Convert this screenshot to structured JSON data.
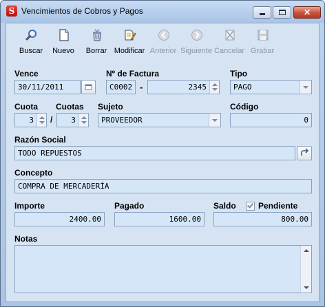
{
  "window": {
    "title": "Vencimientos de Cobros y Pagos",
    "app_icon_letter": "S",
    "minimize_icon": "minimize-icon",
    "maximize_icon": "maximize-icon",
    "close_glyph": "✕"
  },
  "toolbar": {
    "items": [
      {
        "label": "Buscar",
        "icon": "search-icon",
        "enabled": true
      },
      {
        "label": "Nuevo",
        "icon": "new-document-icon",
        "enabled": true
      },
      {
        "label": "Borrar",
        "icon": "recycle-bin-icon",
        "enabled": true
      },
      {
        "label": "Modificar",
        "icon": "edit-document-icon",
        "enabled": true
      },
      {
        "label": "Anterior",
        "icon": "arrow-left-icon",
        "enabled": false
      },
      {
        "label": "Siguiente",
        "icon": "arrow-right-icon",
        "enabled": false
      },
      {
        "label": "Cancelar",
        "icon": "cancel-icon",
        "enabled": false
      },
      {
        "label": "Grabar",
        "icon": "save-icon",
        "enabled": false
      }
    ]
  },
  "form": {
    "vence": {
      "label": "Vence",
      "value": "30/11/2011"
    },
    "factura": {
      "label": "Nº de Factura",
      "prefix": "C0002",
      "separator": "-",
      "number": "2345"
    },
    "tipo": {
      "label": "Tipo",
      "value": "PAGO"
    },
    "cuota": {
      "label": "Cuota",
      "value": "3"
    },
    "cuota_separator": "/",
    "cuotas": {
      "label": "Cuotas",
      "value": "3"
    },
    "sujeto": {
      "label": "Sujeto",
      "value": "PROVEEDOR"
    },
    "codigo": {
      "label": "Código",
      "value": "0"
    },
    "razon_social": {
      "label": "Razón Social",
      "value": "TODO REPUESTOS"
    },
    "concepto": {
      "label": "Concepto",
      "value": "COMPRA DE MERCADERÍA"
    },
    "importe": {
      "label": "Importe",
      "value": "2400.00"
    },
    "pagado": {
      "label": "Pagado",
      "value": "1600.00"
    },
    "saldo": {
      "label": "Saldo",
      "value": "800.00"
    },
    "pendiente": {
      "label": "Pendiente",
      "checked": true
    },
    "notas": {
      "label": "Notas",
      "value": ""
    }
  },
  "colors": {
    "field_bg": "#d4e6f8",
    "client_bg": "#d6e3f3",
    "close_button": "#c8523b"
  }
}
